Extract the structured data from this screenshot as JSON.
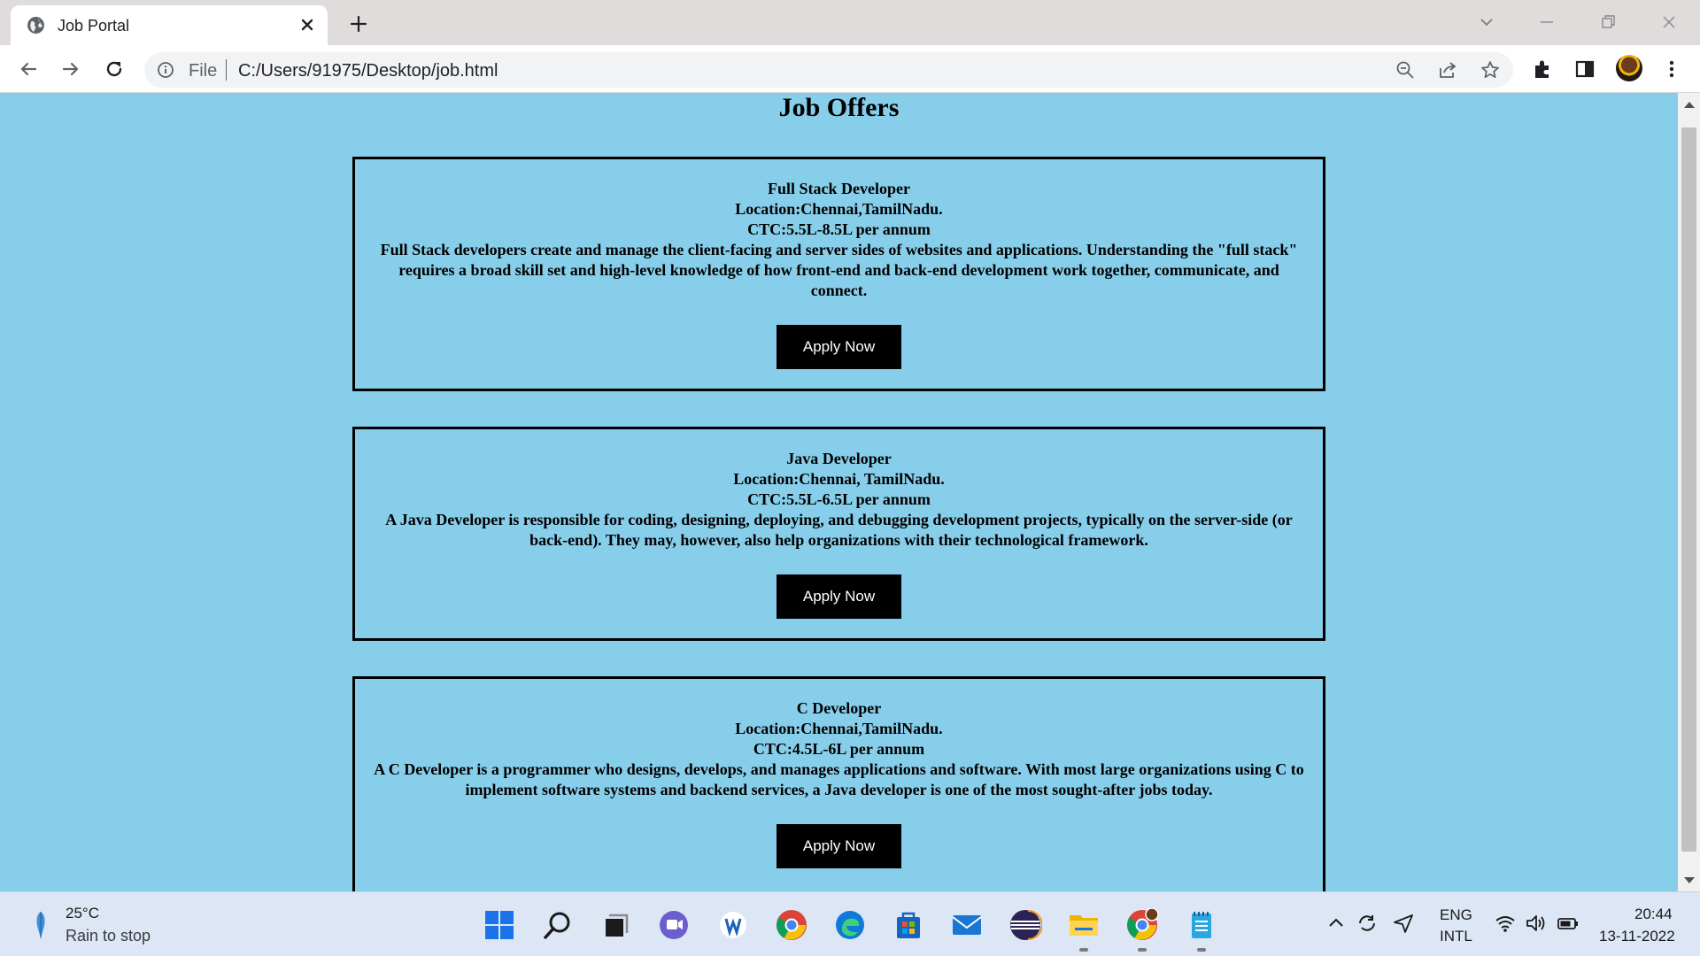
{
  "browser": {
    "tab_title": "Job Portal",
    "url_scheme_label": "File",
    "url": "C:/Users/91975/Desktop/job.html"
  },
  "page": {
    "title": "Job Offers",
    "background": "#87ceeb",
    "jobs": [
      {
        "title": "Full Stack Developer",
        "location": "Location:Chennai,TamilNadu.",
        "ctc": "CTC:5.5L-8.5L per annum",
        "description": "Full Stack developers create and manage the client-facing and server sides of websites and applications. Understanding the \"full stack\" requires a broad skill set and high-level knowledge of how front-end and back-end development work together, communicate, and connect.",
        "button": "Apply Now"
      },
      {
        "title": "Java Developer",
        "location": "Location:Chennai, TamilNadu.",
        "ctc": "CTC:5.5L-6.5L per annum",
        "description": "A Java Developer is responsible for coding, designing, deploying, and debugging development projects, typically on the server-side (or back-end). They may, however, also help organizations with their technological framework.",
        "button": "Apply Now"
      },
      {
        "title": "C Developer",
        "location": "Location:Chennai,TamilNadu.",
        "ctc": "CTC:4.5L-6L per annum",
        "description": "A C Developer is a programmer who designs, develops, and manages applications and software. With most large organizations using C to implement software systems and backend services, a Java developer is one of the most sought-after jobs today.",
        "button": "Apply Now"
      }
    ]
  },
  "taskbar": {
    "weather_temp": "25°C",
    "weather_desc": "Rain to stop",
    "lang_line1": "ENG",
    "lang_line2": "INTL",
    "time": "20:44",
    "date": "13-11-2022",
    "apps": [
      "start-icon",
      "search-icon",
      "task-view-icon",
      "teams-chat-icon",
      "word-icon",
      "chrome-icon",
      "edge-icon",
      "store-icon",
      "mail-icon",
      "eclipse-icon",
      "file-explorer-icon",
      "chrome-profile-icon",
      "notepad-icon"
    ]
  }
}
